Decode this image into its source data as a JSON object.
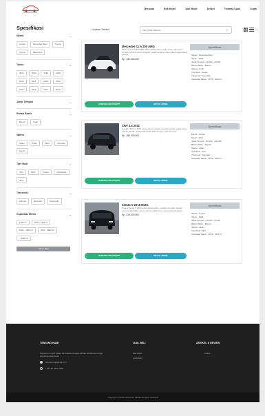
{
  "nav": {
    "items": [
      "Beranda",
      "Beli Mobil",
      "Jual Mobil",
      "Artikel",
      "Tentang Kami",
      "Login"
    ]
  },
  "sidebar": {
    "title": "Spesifikasi",
    "reset_label": "Hapus filter",
    "filters": [
      {
        "label": "Merek",
        "tags": [
          "Honda",
          "Mercedes Benz",
          "Toyota",
          "Suzuki",
          "Mitsubishi"
        ]
      },
      {
        "label": "Tahun",
        "tags": [
          "2021",
          "2020",
          "2019",
          "2018",
          "2017",
          "2016",
          "2015",
          "2014",
          "2013",
          "2012",
          "2011",
          "2010"
        ]
      },
      {
        "label": "Jarak Tempuh",
        "tags": []
      },
      {
        "label": "Bahan Bakar",
        "tags": [
          "Bensin",
          "Solar"
        ]
      },
      {
        "label": "Warna",
        "tags": [
          "Hitam",
          "Putih",
          "Silver",
          "Abu-Abu",
          "Merah"
        ]
      },
      {
        "label": "Tipe Bodi",
        "tags": [
          "SUV",
          "MPV",
          "Sedan",
          "Hatchback",
          "Jeep"
        ]
      },
      {
        "label": "Transmisi",
        "tags": [
          "Manual",
          "Otomatis",
          "Campuran"
        ]
      },
      {
        "label": "Kapasitas Mesin",
        "tags": [
          "1000 cc",
          "1001 - 1500 cc",
          "1501 - 2000 cc",
          "2001 - 3000 cc",
          "> 3000 cc"
        ]
      }
    ]
  },
  "toolbar": {
    "sort_label": "Urutkan: Default",
    "search_placeholder": "Cari mobil idaman..."
  },
  "cars": [
    {
      "name": "Mercedes CLA 200 AMG",
      "desc": "Mercedes CLA 200 AMG tahun 2018 warna putih mulus, kilometer rendah, service record lengkap, pajak panjang, siap pakai tinggal bawa pulang...",
      "price": "Rp. 450.000.000",
      "spec_title": "Spesifikasi",
      "specs": [
        "Merek : Mercedes Benz",
        "Tahun : 2018",
        "Jarak Tempuh : 20.000 - 25.000",
        "Bahan Bakar : Bensin",
        "Warna : Putih",
        "Tipe Bodi : Sedan",
        "Transmisi : Otomatis",
        "Kapasitas Mesin : 1501 - 2000 cc"
      ],
      "btn_contact": "HUBUNGI WHATSAPP",
      "btn_detail": "DETAIL MOBIL"
    },
    {
      "name": "CRV 2.4 2011",
      "desc": "Honda CRV 2.4 2011 warna hitam metalik, kondisi terawat, pajak hidup, interior bersih, mesin halus, kaki-kaki senyap, siap luar kota...",
      "price": "Rp. 185.000.000",
      "spec_title": "Spesifikasi",
      "specs": [
        "Merek : Honda",
        "Tahun : 2011",
        "Jarak Tempuh : 80.000 - 100.000",
        "Bahan Bakar : Bensin",
        "Warna : Hitam",
        "Tipe Bodi : SUV",
        "Transmisi : Otomatis",
        "Kapasitas Mesin : 2001 - 3000 cc"
      ],
      "btn_contact": "HUBUNGI WHATSAPP",
      "btn_detail": "DETAIL MOBIL"
    },
    {
      "name": "Sienta V 2018 Matic",
      "desc": "Toyota Sienta V 2018 matic warna hitam, kondisi istimewa, tangan pertama dari baru, servis rutin bengkel resmi, siap pakai keluarga...",
      "price": "Rp. 215.000.000",
      "spec_title": "Spesifikasi",
      "specs": [
        "Merek : Toyota",
        "Tahun : 2018",
        "Jarak Tempuh : 15.000 - 20.000",
        "Bahan Bakar : Bensin",
        "Warna : Hitam",
        "Tipe Bodi : MPV",
        "Kapasitas Mesin : 1001 - 1500 cc"
      ],
      "btn_contact": "HUBUNGI WHATSAPP",
      "btn_detail": "DETAIL MOBIL"
    }
  ],
  "footer": {
    "about_title": "TENTANG KAMI",
    "about_text": "Showroom mobil bekas berkualitas dengan pilihan terbaik dan harga bersaing untuk Anda.",
    "email": "showroom@gmail.com",
    "phone": "+62 812 3456 7890",
    "sell_title": "JUAL BELI",
    "sell_links": [
      "Beli Mobil",
      "Jual Mobil"
    ],
    "article_title": "ARTIKEL & REVIEW",
    "article_links": [
      "Artikel"
    ],
    "copyright": "Copyright © 2021 Showroom Mobil | All rights reserved"
  },
  "colors": {
    "green": "#2ab27b",
    "teal": "#2aa9c4",
    "spec_header": "#c5ccd3",
    "footer": "#1f1f1f"
  }
}
